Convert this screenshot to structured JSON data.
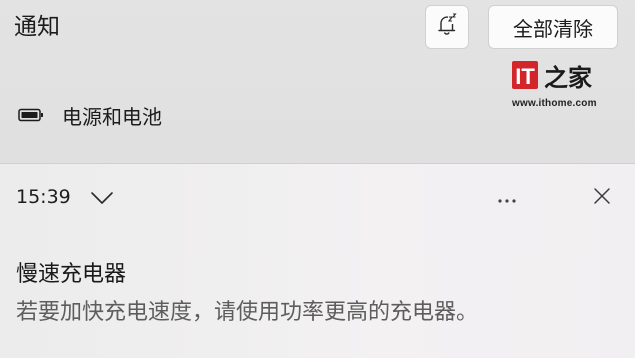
{
  "header": {
    "title": "通知",
    "dnd_icon": "bell-snooze-icon",
    "clear_all_label": "全部清除"
  },
  "watermark": {
    "brand_text": "IT之家",
    "url": "www.ithome.com",
    "brand_color": "#d2262a"
  },
  "app_group": {
    "icon": "battery-icon",
    "name": "电源和电池"
  },
  "notification": {
    "time": "15:39",
    "expand_icon": "chevron-down-icon",
    "more_icon": "more-horizontal-icon",
    "close_icon": "close-icon",
    "title": "慢速充电器",
    "body": "若要加快充电速度，请使用功率更高的充电器。"
  }
}
